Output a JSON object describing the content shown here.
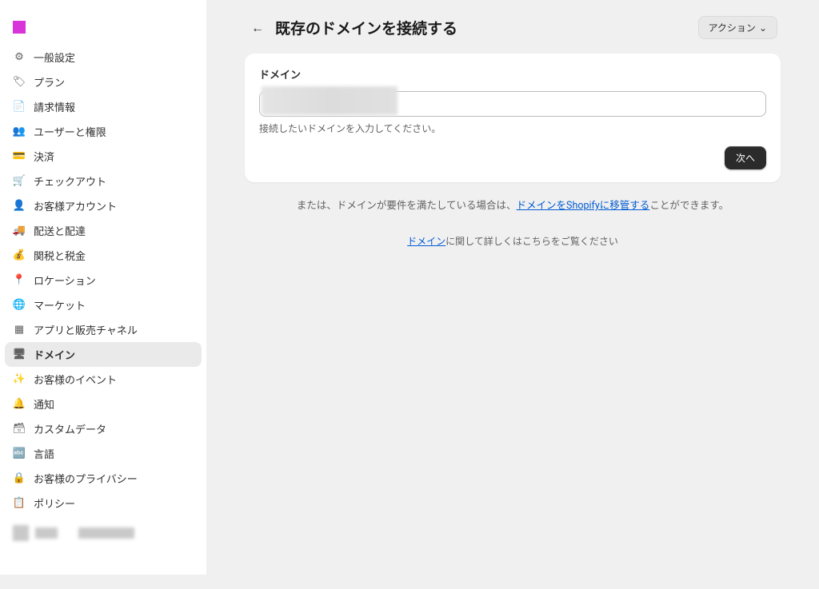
{
  "sidebar": {
    "items": [
      {
        "icon": "gear-icon",
        "label": "一般設定",
        "glyph": "⚙"
      },
      {
        "icon": "tag-icon",
        "label": "プラン",
        "glyph": "🏷"
      },
      {
        "icon": "document-icon",
        "label": "請求情報",
        "glyph": "📄"
      },
      {
        "icon": "users-icon",
        "label": "ユーザーと権限",
        "glyph": "👥"
      },
      {
        "icon": "credit-card-icon",
        "label": "決済",
        "glyph": "💳"
      },
      {
        "icon": "cart-icon",
        "label": "チェックアウト",
        "glyph": "🛒"
      },
      {
        "icon": "person-icon",
        "label": "お客様アカウント",
        "glyph": "👤"
      },
      {
        "icon": "truck-icon",
        "label": "配送と配達",
        "glyph": "🚚"
      },
      {
        "icon": "money-bag-icon",
        "label": "関税と税金",
        "glyph": "💰"
      },
      {
        "icon": "location-icon",
        "label": "ロケーション",
        "glyph": "📍"
      },
      {
        "icon": "globe-icon",
        "label": "マーケット",
        "glyph": "🌐"
      },
      {
        "icon": "grid-icon",
        "label": "アプリと販売チャネル",
        "glyph": "▦"
      },
      {
        "icon": "domain-icon",
        "label": "ドメイン",
        "glyph": "🖥"
      },
      {
        "icon": "event-icon",
        "label": "お客様のイベント",
        "glyph": "✨"
      },
      {
        "icon": "bell-icon",
        "label": "通知",
        "glyph": "🔔"
      },
      {
        "icon": "database-icon",
        "label": "カスタムデータ",
        "glyph": "🗃"
      },
      {
        "icon": "language-icon",
        "label": "言語",
        "glyph": "🔤"
      },
      {
        "icon": "lock-icon",
        "label": "お客様のプライバシー",
        "glyph": "🔒"
      },
      {
        "icon": "policy-icon",
        "label": "ポリシー",
        "glyph": "📋"
      }
    ],
    "active_index": 12
  },
  "header": {
    "title": "既存のドメインを接続する",
    "action_label": "アクション"
  },
  "card": {
    "title": "ドメイン",
    "helper": "接続したいドメインを入力してください。",
    "next_label": "次へ"
  },
  "footer_lines": {
    "prefix1": "または、ドメインが要件を満たしている場合は、",
    "link1": "ドメインをShopifyに移管する",
    "suffix1": "ことができます。",
    "link2": "ドメイン",
    "suffix2": "に関して詳しくはこちらをご覧ください"
  }
}
